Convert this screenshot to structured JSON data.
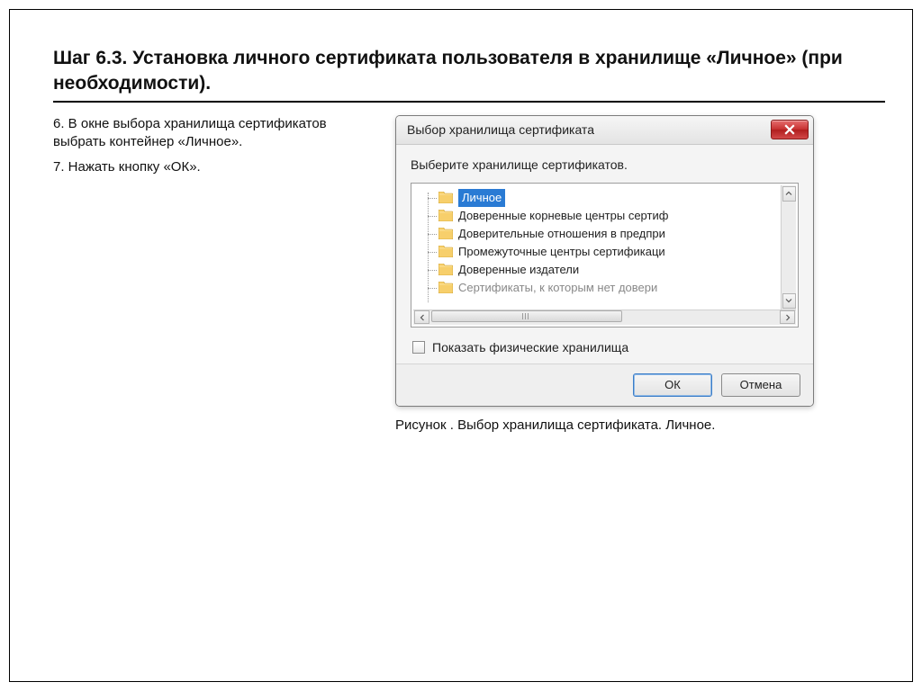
{
  "heading": "Шаг 6.3. Установка личного сертификата пользователя в хранилище «Личное» (при необходимости).",
  "instructions": {
    "item6": "6. В окне выбора хранилища сертификатов выбрать контейнер «Личное».",
    "item7": "7. Нажать кнопку «ОК»."
  },
  "dialog": {
    "title": "Выбор хранилища сертификата",
    "prompt": "Выберите хранилище сертификатов.",
    "tree": {
      "items": [
        {
          "label": "Личное",
          "selected": true
        },
        {
          "label": "Доверенные корневые центры сертиф"
        },
        {
          "label": "Доверительные отношения в предпри"
        },
        {
          "label": "Промежуточные центры сертификаци"
        },
        {
          "label": "Доверенные издатели"
        },
        {
          "label": "Сертификаты, к которым нет довери",
          "cut": true
        }
      ]
    },
    "checkbox_label": "Показать физические хранилища",
    "ok_label": "ОК",
    "cancel_label": "Отмена"
  },
  "caption": "Рисунок . Выбор хранилища сертификата. Личное."
}
